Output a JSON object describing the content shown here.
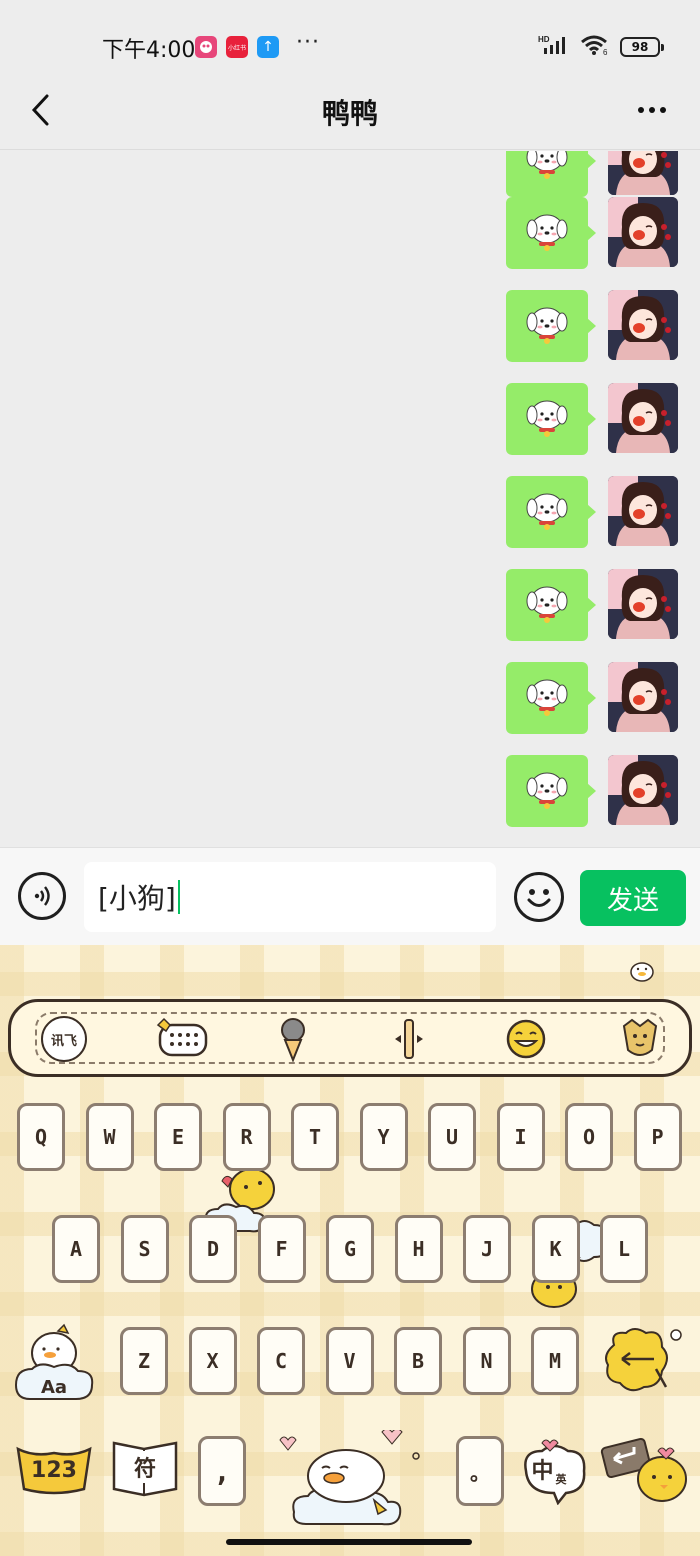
{
  "status_bar": {
    "time": "下午4:00",
    "notif_icons": [
      {
        "name": "app-icon-1",
        "color": "#e7467a",
        "glyph": "●"
      },
      {
        "name": "xiaohongshu-icon",
        "color": "#e8213b",
        "glyph": "小红书"
      },
      {
        "name": "upload-app-icon",
        "color": "#1e9af5",
        "glyph": "↑"
      }
    ],
    "dots": "···",
    "network": "HD",
    "wifi_badge": "6",
    "battery": "98"
  },
  "nav": {
    "title": "鸭鸭"
  },
  "chat": {
    "messages": [
      {
        "type": "sticker",
        "sticker": "white-puppy-sticker"
      },
      {
        "type": "sticker",
        "sticker": "white-puppy-sticker"
      },
      {
        "type": "sticker",
        "sticker": "white-puppy-sticker"
      },
      {
        "type": "sticker",
        "sticker": "white-puppy-sticker"
      },
      {
        "type": "sticker",
        "sticker": "white-puppy-sticker"
      },
      {
        "type": "sticker",
        "sticker": "white-puppy-sticker"
      },
      {
        "type": "sticker",
        "sticker": "white-puppy-sticker"
      },
      {
        "type": "sticker",
        "sticker": "white-puppy-sticker"
      }
    ],
    "bubble_color": "#95ec69"
  },
  "input": {
    "value": "[小狗]",
    "send_label": "发送"
  },
  "keyboard": {
    "toolbar_xunfei": "讯飞",
    "row1": [
      "Q",
      "W",
      "E",
      "R",
      "T",
      "Y",
      "U",
      "I",
      "O",
      "P"
    ],
    "row2": [
      "A",
      "S",
      "D",
      "F",
      "G",
      "H",
      "J",
      "K",
      "L"
    ],
    "row3": [
      "Z",
      "X",
      "C",
      "V",
      "B",
      "N",
      "M"
    ],
    "shift_label": "Aa",
    "numbers_label": "123",
    "symbols_label": "符",
    "comma_label": ",",
    "period_label": "。",
    "lang_label": "中",
    "lang_sub": "英"
  },
  "colors": {
    "accent": "#07c160",
    "keyboard_bg": "#fcf4dc"
  }
}
